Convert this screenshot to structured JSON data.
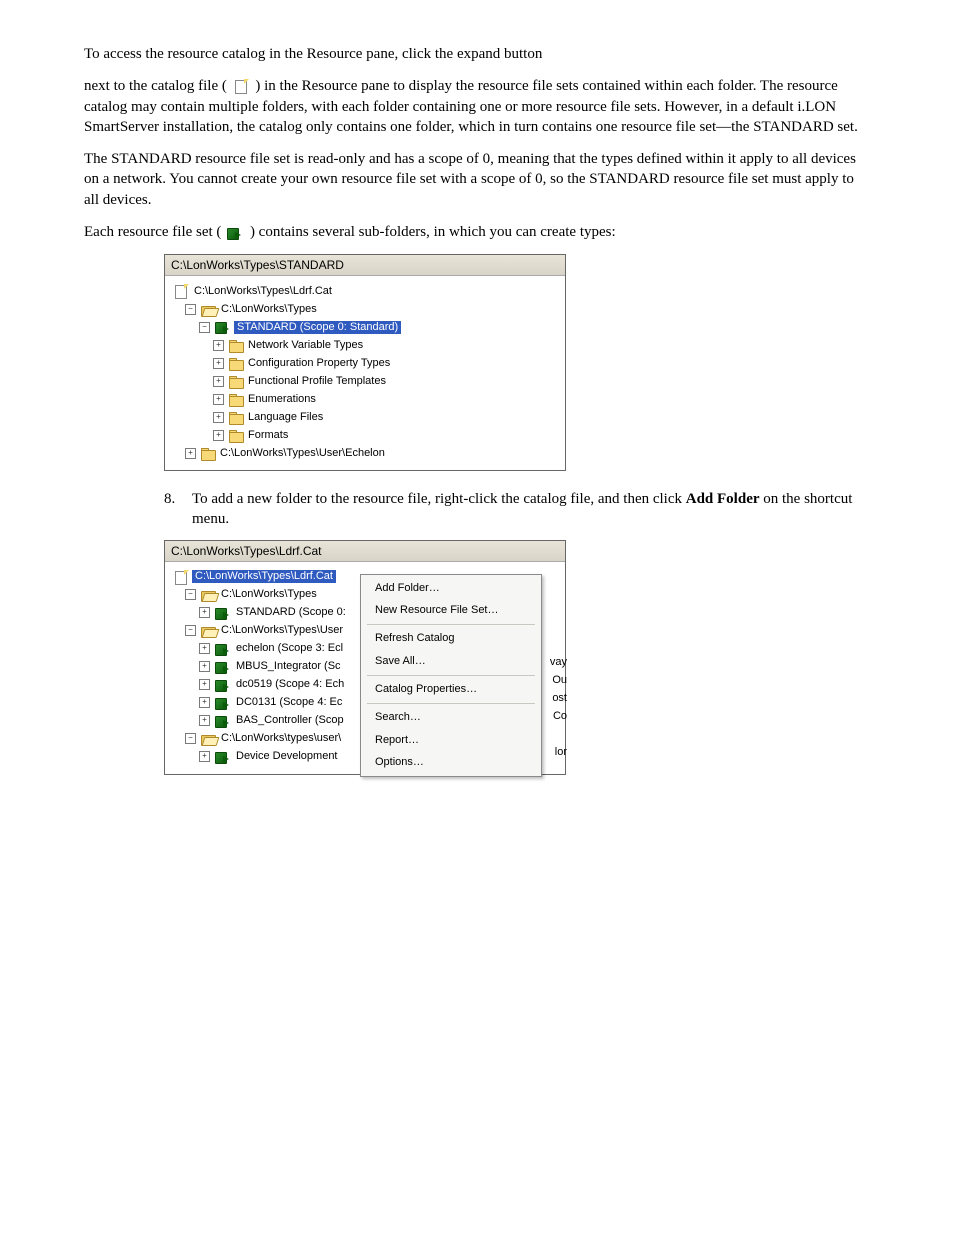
{
  "body": {
    "p1a": "To access the resource catalog in the Resource pane, click the expand button",
    "p1b_prefix": "next to the catalog file (",
    "p1b_suffix": ") in the",
    "p2": "Resource pane to display the resource file sets contained within each folder. The resource catalog may contain multiple folders, with each folder containing one or more resource file sets. However, in a default i.LON SmartServer installation, the catalog only contains one folder, which in turn contains one resource file set—the STANDARD set.",
    "p3": "The STANDARD resource file set is read-only and has a scope of 0, meaning that the types defined within it apply to all devices on a network. You cannot create your own resource file set with a scope of 0, so the STANDARD resource file set must apply to all devices.",
    "p4_prefix": "Each resource file set (",
    "p4_suffix": ") contains several sub-folders, in which you can create types:"
  },
  "instr1": {
    "num": "8.",
    "text_a": "To add a new folder to the resource file, right-click the catalog file, and then click ",
    "bold": "Add Folder",
    "text_b": " on the shortcut menu."
  },
  "panel1": {
    "header": "C:\\LonWorks\\Types\\STANDARD",
    "root": "C:\\LonWorks\\Types\\Ldrf.Cat",
    "folder1": "C:\\LonWorks\\Types",
    "selected": "STANDARD (Scope 0: Standard)",
    "nvt": "Network Variable Types",
    "cpt": "Configuration Property Types",
    "fpt": "Functional Profile Templates",
    "enum": "Enumerations",
    "lang": "Language Files",
    "fmt": "Formats",
    "folder2": "C:\\LonWorks\\Types\\User\\Echelon"
  },
  "panel2": {
    "header": "C:\\LonWorks\\Types\\Ldrf.Cat",
    "root": "C:\\LonWorks\\Types\\Ldrf.Cat",
    "folder1": "C:\\LonWorks\\Types",
    "standard": "STANDARD (Scope 0:",
    "folder2": "C:\\LonWorks\\Types\\User",
    "echelon": "echelon (Scope 3: Ecl",
    "mbus": "MBUS_Integrator (Sc",
    "dc0519": "dc0519 (Scope 4: Ech",
    "dc0131": "DC0131 (Scope 4: Ec",
    "bas": "BAS_Controller (Scop",
    "folder3": "C:\\LonWorks\\types\\user\\",
    "devdev": "Device Development"
  },
  "menu": {
    "add_folder": "Add Folder…",
    "new_set": "New Resource File Set…",
    "refresh": "Refresh Catalog",
    "save_all": "Save All…",
    "cat_props": "Catalog Properties…",
    "search": "Search…",
    "report": "Report…",
    "options": "Options…"
  },
  "shadow": {
    "s1": "vay",
    "s2": "Ou",
    "s3": "ost",
    "s4": "Co",
    "s5": "lor"
  }
}
